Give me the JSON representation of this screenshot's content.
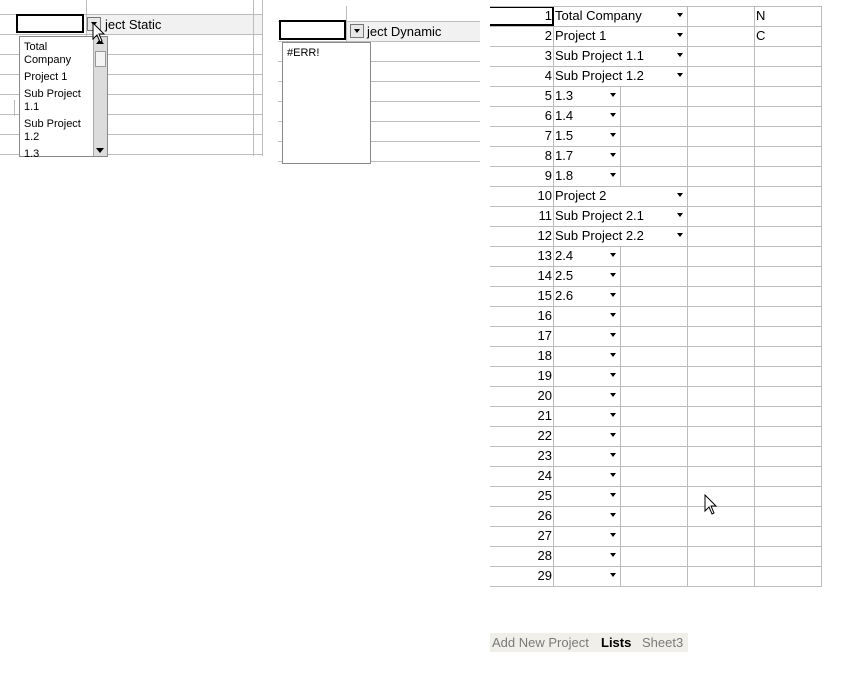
{
  "static_panel": {
    "header_label": "ject Static",
    "dropdown_items": [
      "Total Company",
      "Project 1",
      "Sub Project 1.1",
      "Sub Project 1.2",
      "1.3"
    ]
  },
  "dynamic_panel": {
    "header_label": "ject Dynamic",
    "dropdown_items": [
      "#ERR!"
    ]
  },
  "lists_sheet": {
    "rows": [
      {
        "num": "1",
        "value": "Total Company",
        "extra": "N"
      },
      {
        "num": "2",
        "value": "Project 1",
        "extra": "C"
      },
      {
        "num": "3",
        "value": "Sub Project 1.1",
        "extra": ""
      },
      {
        "num": "4",
        "value": "Sub Project 1.2",
        "extra": ""
      },
      {
        "num": "5",
        "value": "1.3",
        "extra": ""
      },
      {
        "num": "6",
        "value": "1.4",
        "extra": ""
      },
      {
        "num": "7",
        "value": "1.5",
        "extra": ""
      },
      {
        "num": "8",
        "value": "1.7",
        "extra": ""
      },
      {
        "num": "9",
        "value": "1.8",
        "extra": ""
      },
      {
        "num": "10",
        "value": "Project 2",
        "extra": ""
      },
      {
        "num": "11",
        "value": "Sub Project 2.1",
        "extra": ""
      },
      {
        "num": "12",
        "value": "Sub Project 2.2",
        "extra": ""
      },
      {
        "num": "13",
        "value": "2.4",
        "extra": ""
      },
      {
        "num": "14",
        "value": "2.5",
        "extra": ""
      },
      {
        "num": "15",
        "value": "2.6",
        "extra": ""
      },
      {
        "num": "16",
        "value": "",
        "extra": ""
      },
      {
        "num": "17",
        "value": "",
        "extra": ""
      },
      {
        "num": "18",
        "value": "",
        "extra": ""
      },
      {
        "num": "19",
        "value": "",
        "extra": ""
      },
      {
        "num": "20",
        "value": "",
        "extra": ""
      },
      {
        "num": "21",
        "value": "",
        "extra": ""
      },
      {
        "num": "22",
        "value": "",
        "extra": ""
      },
      {
        "num": "23",
        "value": "",
        "extra": ""
      },
      {
        "num": "24",
        "value": "",
        "extra": ""
      },
      {
        "num": "25",
        "value": "",
        "extra": ""
      },
      {
        "num": "26",
        "value": "",
        "extra": ""
      },
      {
        "num": "27",
        "value": "",
        "extra": ""
      },
      {
        "num": "28",
        "value": "",
        "extra": ""
      },
      {
        "num": "29",
        "value": "",
        "extra": ""
      }
    ]
  },
  "sheet_tabs": {
    "tab1": "Add New Project",
    "tab2": "Lists",
    "tab3": "Sheet3",
    "active": "Lists"
  }
}
